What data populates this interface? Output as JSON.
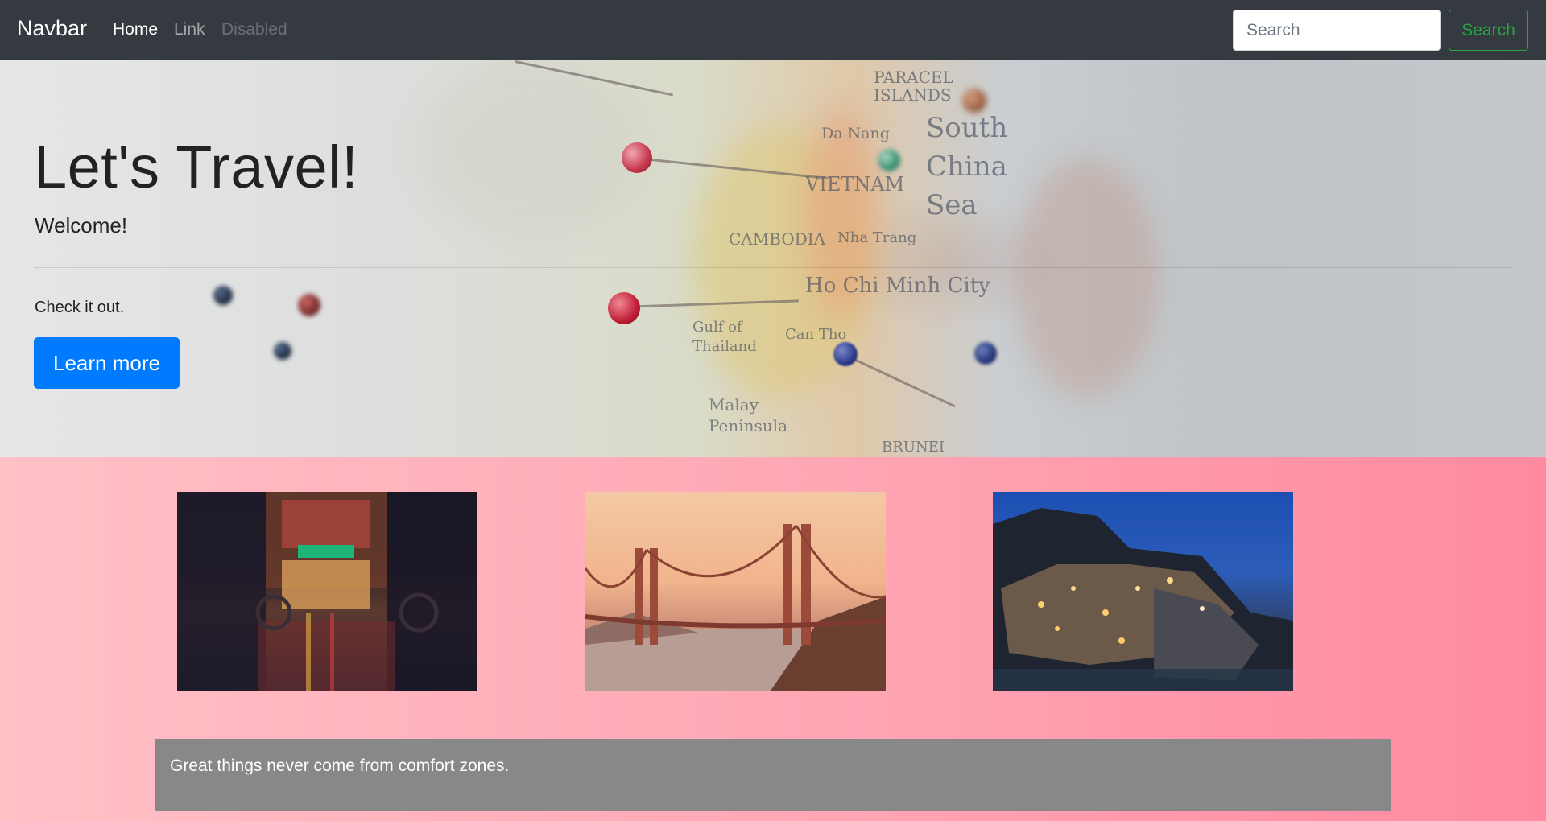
{
  "navbar": {
    "brand": "Navbar",
    "links": [
      {
        "label": "Home"
      },
      {
        "label": "Link"
      },
      {
        "label": "Disabled"
      }
    ],
    "search": {
      "placeholder": "Search",
      "button_label": "Search"
    }
  },
  "jumbotron": {
    "title": "Let's Travel!",
    "lead": "Welcome!",
    "text": "Check it out.",
    "button_label": "Learn more",
    "map_labels": [
      "PARACEL ISLANDS",
      "Da Nang",
      "VIETNAM",
      "South China Sea",
      "CAMBODIA",
      "Nha Trang",
      "Ho Chi Minh City",
      "Can Tho",
      "Gulf of Thailand",
      "Malay Peninsula",
      "BRUNEI"
    ]
  },
  "quote": {
    "text": "Great things never come from comfort zones."
  },
  "colors": {
    "navbar_bg": "#343a40",
    "primary": "#007bff",
    "success": "#28a745",
    "quote_bg": "#888888"
  }
}
